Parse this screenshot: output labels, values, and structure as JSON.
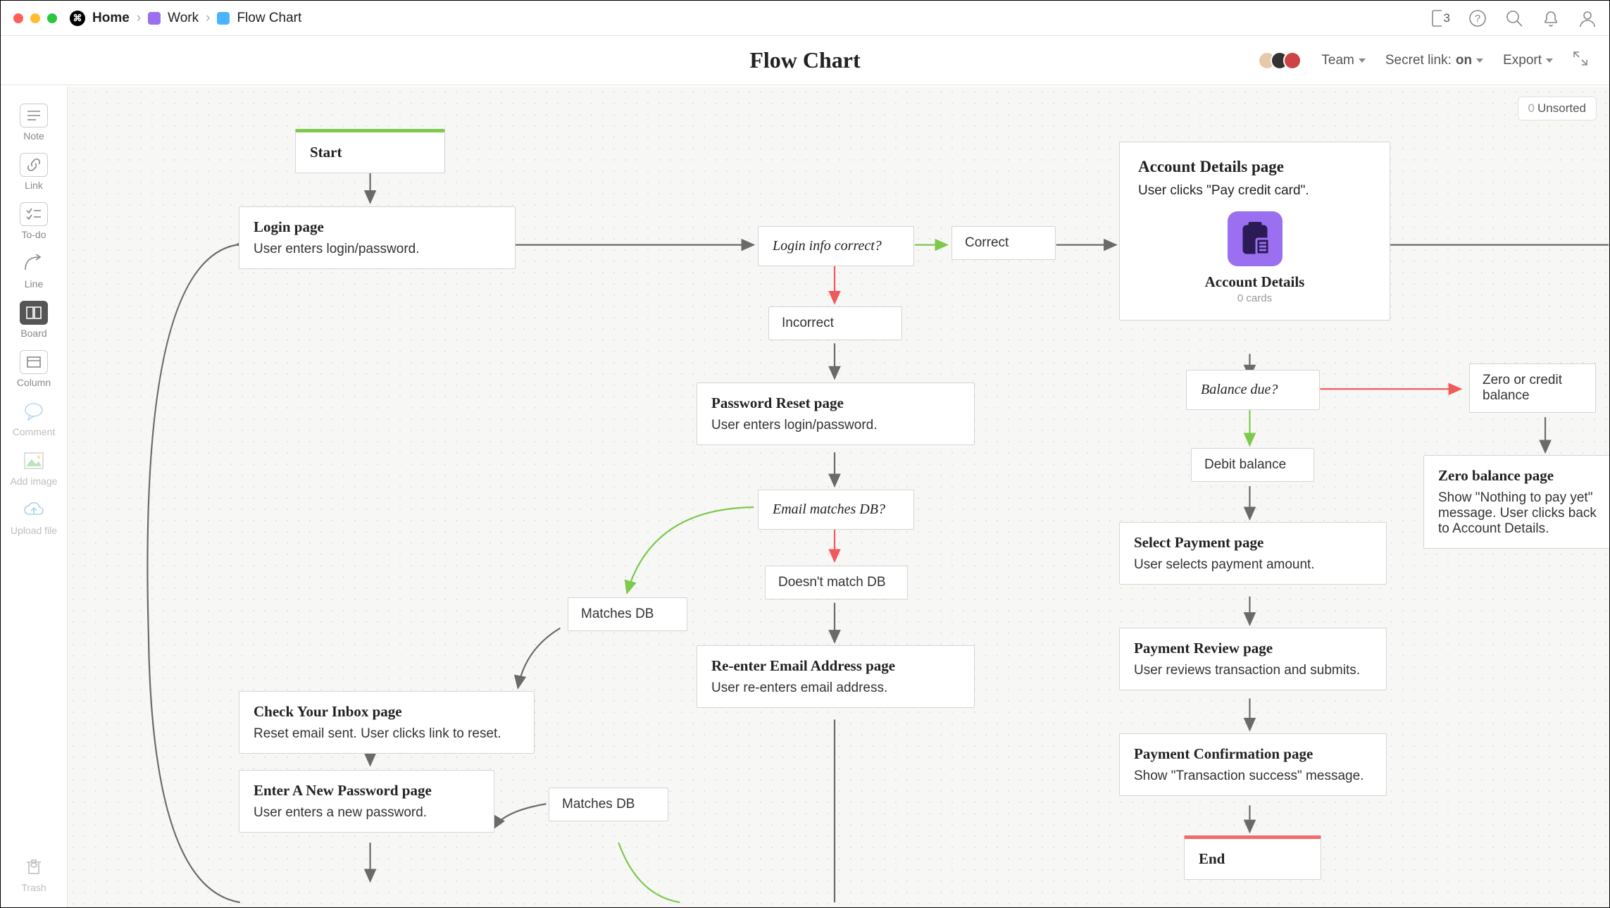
{
  "breadcrumb": {
    "home": "Home",
    "work": "Work",
    "page": "Flow Chart"
  },
  "page_title": "Flow Chart",
  "mobile_badge": "3",
  "header": {
    "team": "Team",
    "secret_prefix": "Secret link:",
    "secret_state": "on",
    "export": "Export"
  },
  "sidebar": {
    "note": "Note",
    "link": "Link",
    "todo": "To-do",
    "line": "Line",
    "board": "Board",
    "column": "Column",
    "comment": "Comment",
    "add_image": "Add image",
    "upload": "Upload file",
    "trash": "Trash"
  },
  "unsorted": {
    "count": "0",
    "label": "Unsorted"
  },
  "nodes": {
    "start": {
      "title": "Start"
    },
    "login": {
      "title": "Login page",
      "desc": "User enters login/password."
    },
    "login_correct": {
      "title": "Login info correct?"
    },
    "correct": {
      "desc": "Correct"
    },
    "incorrect": {
      "desc": "Incorrect"
    },
    "pwreset": {
      "title": "Password Reset page",
      "desc": "User enters login/password."
    },
    "emailmatch": {
      "title": "Email matches DB?"
    },
    "nomatch": {
      "desc": "Doesn't match DB"
    },
    "matches1": {
      "desc": "Matches DB"
    },
    "reenter": {
      "title": "Re-enter Email Address page",
      "desc": "User re-enters email address."
    },
    "inbox": {
      "title": "Check Your Inbox page",
      "desc": "Reset email sent. User clicks link to reset."
    },
    "newpw": {
      "title": "Enter A New Password page",
      "desc": "User enters a new password."
    },
    "matches2": {
      "desc": "Matches DB"
    },
    "account": {
      "title": "Account Details page",
      "desc": "User clicks \"Pay credit card\".",
      "board": "Account Details",
      "cards": "0 cards"
    },
    "balance": {
      "title": "Balance due?"
    },
    "debit": {
      "desc": "Debit balance"
    },
    "zerolab": {
      "desc": "Zero or credit balance"
    },
    "select": {
      "title": "Select Payment page",
      "desc": "User selects payment amount."
    },
    "review": {
      "title": "Payment Review page",
      "desc": "User reviews transaction and submits."
    },
    "confirm": {
      "title": "Payment Confirmation page",
      "desc": "Show \"Transaction success\" message."
    },
    "zero": {
      "title": "Zero balance page",
      "desc": "Show \"Nothing to pay yet\" message. User clicks back to Account Details."
    },
    "end": {
      "title": "End"
    }
  }
}
